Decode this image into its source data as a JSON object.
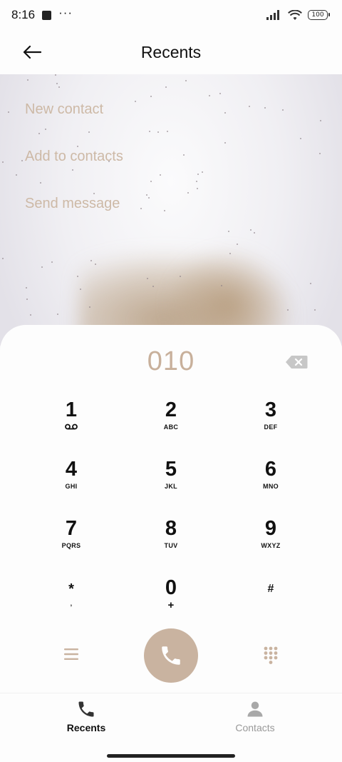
{
  "status_bar": {
    "time": "8:16",
    "dots": "···",
    "battery": "100"
  },
  "header": {
    "title": "Recents"
  },
  "options": [
    {
      "label": "New contact"
    },
    {
      "label": "Add to contacts"
    },
    {
      "label": "Send message"
    }
  ],
  "dialer": {
    "number": "010",
    "keys": [
      {
        "digit": "1",
        "letters": ""
      },
      {
        "digit": "2",
        "letters": "ABC"
      },
      {
        "digit": "3",
        "letters": "DEF"
      },
      {
        "digit": "4",
        "letters": "GHI"
      },
      {
        "digit": "5",
        "letters": "JKL"
      },
      {
        "digit": "6",
        "letters": "MNO"
      },
      {
        "digit": "7",
        "letters": "PQRS"
      },
      {
        "digit": "8",
        "letters": "TUV"
      },
      {
        "digit": "9",
        "letters": "WXYZ"
      },
      {
        "digit": "*",
        "letters": ","
      },
      {
        "digit": "0",
        "letters": "+"
      },
      {
        "digit": "#",
        "letters": ""
      }
    ]
  },
  "bottom_nav": {
    "recents": "Recents",
    "contacts": "Contacts"
  },
  "colors": {
    "accent": "#c9b3a0",
    "option_text": "#cdb9a6",
    "number_text": "#c8b09b"
  }
}
